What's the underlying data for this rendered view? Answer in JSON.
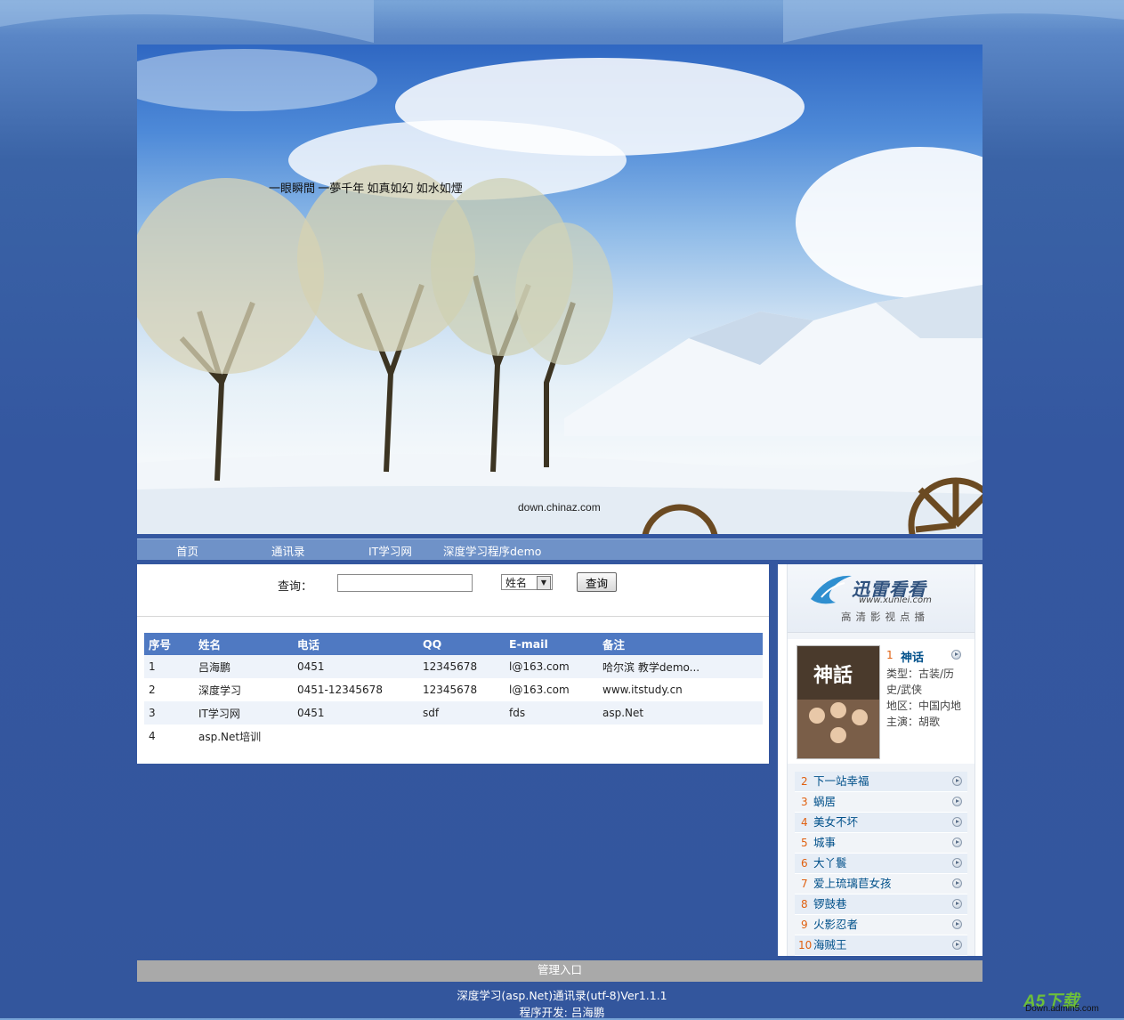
{
  "banner": {
    "poem": "一眼瞬間 一夢千年 如真如幻 如水如煙",
    "credit": "down.chinaz.com"
  },
  "nav": [
    "首页",
    "通讯录",
    "IT学习网",
    "深度学习程序demo"
  ],
  "search": {
    "label": "查询：",
    "input_value": "",
    "select_value": "姓名",
    "button": "查询"
  },
  "table": {
    "headers": [
      "序号",
      "姓名",
      "电话",
      "QQ",
      "E-mail",
      "备注"
    ],
    "rows": [
      [
        "1",
        "吕海鹏",
        "0451",
        "12345678",
        "l@163.com",
        "哈尔滨 教学demo..."
      ],
      [
        "2",
        "深度学习",
        "0451-12345678",
        "12345678",
        "l@163.com",
        "www.itstudy.cn"
      ],
      [
        "3",
        "IT学习网",
        "0451",
        "sdf",
        "fds",
        "asp.Net"
      ],
      [
        "4",
        "asp.Net培训",
        "",
        "",
        "",
        ""
      ]
    ]
  },
  "sidebar": {
    "logo_title": "迅雷看看",
    "logo_url": "www.xunlei.com",
    "logo_subtitle": "高清影视点播",
    "featured": {
      "rank": "1",
      "title": "神话",
      "type": "类型：古装/历史/武侠",
      "region": "地区：中国内地",
      "star": "主演：胡歌",
      "poster_text": "神話"
    },
    "ranks": [
      {
        "num": "2",
        "name": "下一站幸福"
      },
      {
        "num": "3",
        "name": "蜗居"
      },
      {
        "num": "4",
        "name": "美女不坏"
      },
      {
        "num": "5",
        "name": "城事"
      },
      {
        "num": "6",
        "name": "大丫鬟"
      },
      {
        "num": "7",
        "name": "爱上琉璃苣女孩"
      },
      {
        "num": "8",
        "name": "锣鼓巷"
      },
      {
        "num": "9",
        "name": "火影忍者"
      },
      {
        "num": "10",
        "name": "海贼王"
      }
    ]
  },
  "footer": {
    "admin": "管理入口",
    "line1": "深度学习(asp.Net)通讯录(utf-8)Ver1.1.1",
    "line2": "程序开发: 吕海鹏"
  },
  "watermark": {
    "main": "A5下载",
    "sub": "Down.admin5.com"
  },
  "colors": {
    "page_bg": "#3457a0",
    "nav_bg": "#6f92c8",
    "table_header": "#4f79c2",
    "admin_bar": "#a9a9a9",
    "rank_num": "#e06010",
    "rank_name": "#00508a"
  }
}
